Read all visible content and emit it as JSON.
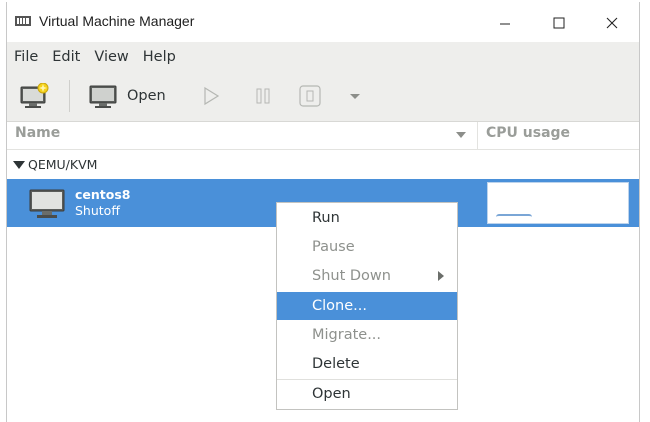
{
  "window": {
    "title": "Virtual Machine Manager"
  },
  "menubar": {
    "items": [
      "File",
      "Edit",
      "View",
      "Help"
    ]
  },
  "toolbar": {
    "open_label": "Open"
  },
  "columns": {
    "name": "Name",
    "cpu": "CPU usage"
  },
  "group": {
    "label": "QEMU/KVM"
  },
  "vm": {
    "name": "centos8",
    "status": "Shutoff"
  },
  "context_menu": {
    "items": [
      {
        "label": "Run",
        "enabled": true
      },
      {
        "label": "Pause",
        "enabled": false
      },
      {
        "label": "Shut Down",
        "enabled": false,
        "submenu": true
      },
      {
        "label": "Clone...",
        "enabled": true,
        "selected": true
      },
      {
        "label": "Migrate...",
        "enabled": false
      },
      {
        "label": "Delete",
        "enabled": true
      },
      {
        "label": "Open",
        "enabled": true
      }
    ]
  },
  "colors": {
    "accent": "#4a90d9",
    "toolbar_bg": "#eeeeec",
    "disabled_text": "#8e918d"
  }
}
